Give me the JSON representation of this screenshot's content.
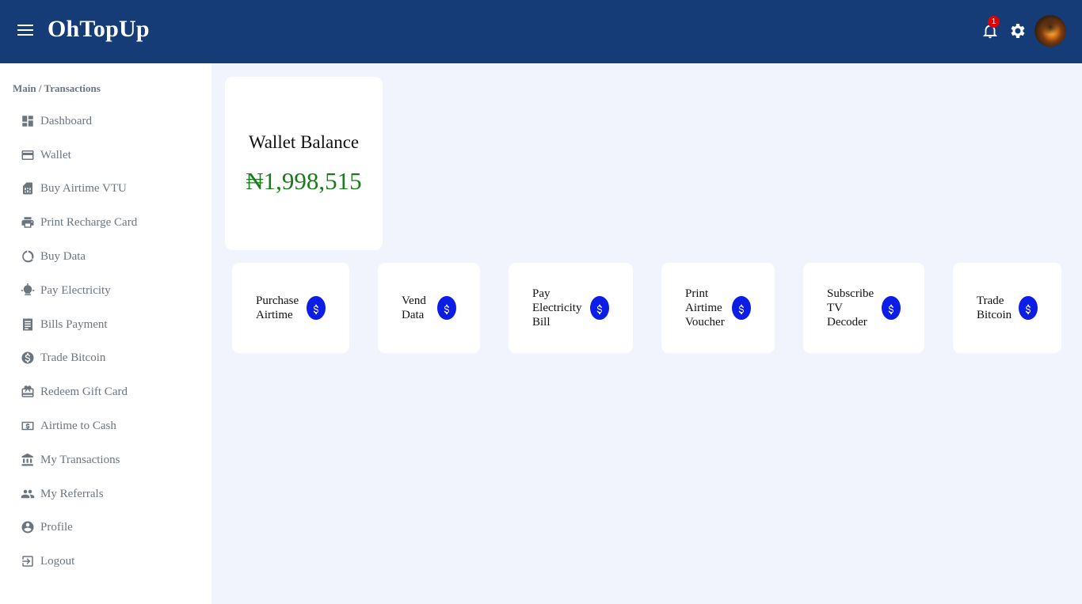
{
  "header": {
    "brand": "OhTopUp",
    "notification_count": "1",
    "icons": [
      "menu-icon",
      "bell-icon",
      "gear-icon",
      "avatar"
    ]
  },
  "sidebar": {
    "breadcrumb": "Main / Transactions",
    "items": [
      {
        "label": "Dashboard",
        "icon": "dashboard-icon"
      },
      {
        "label": "Wallet",
        "icon": "credit-card-icon"
      },
      {
        "label": "Buy Airtime VTU",
        "icon": "sim-card-icon"
      },
      {
        "label": "Print Recharge Card",
        "icon": "printer-icon"
      },
      {
        "label": "Buy Data",
        "icon": "data-usage-icon"
      },
      {
        "label": "Pay Electricity",
        "icon": "light-bulb-icon"
      },
      {
        "label": "Bills Payment",
        "icon": "receipt-icon"
      },
      {
        "label": "Trade Bitcoin",
        "icon": "dollar-icon"
      },
      {
        "label": "Redeem Gift Card",
        "icon": "gift-card-icon"
      },
      {
        "label": "Airtime to Cash",
        "icon": "cash-icon"
      },
      {
        "label": "My Transactions",
        "icon": "bank-icon"
      },
      {
        "label": "My Referrals",
        "icon": "people-icon"
      },
      {
        "label": "Profile",
        "icon": "account-circle-icon"
      },
      {
        "label": "Logout",
        "icon": "logout-icon"
      }
    ]
  },
  "wallet": {
    "title": "Wallet Balance",
    "amount": "₦1,998,515"
  },
  "services": [
    {
      "line1": "Purchase",
      "line2": "Airtime",
      "line3": ""
    },
    {
      "line1": "Vend",
      "line2": "Data",
      "line3": ""
    },
    {
      "line1": "Pay",
      "line2": "Electricity",
      "line3": "Bill"
    },
    {
      "line1": "Print",
      "line2": "Airtime",
      "line3": "Voucher"
    },
    {
      "line1": "Subscribe",
      "line2": "TV",
      "line3": "Decoder"
    },
    {
      "line1": "Trade",
      "line2": "Bitcoin",
      "line3": ""
    }
  ],
  "colors": {
    "header_bg": "#153c76",
    "page_bg": "#f1f4fd",
    "balance_green": "#1a7a1a",
    "coin_blue": "#0c1de6",
    "badge_red": "#e00000"
  }
}
